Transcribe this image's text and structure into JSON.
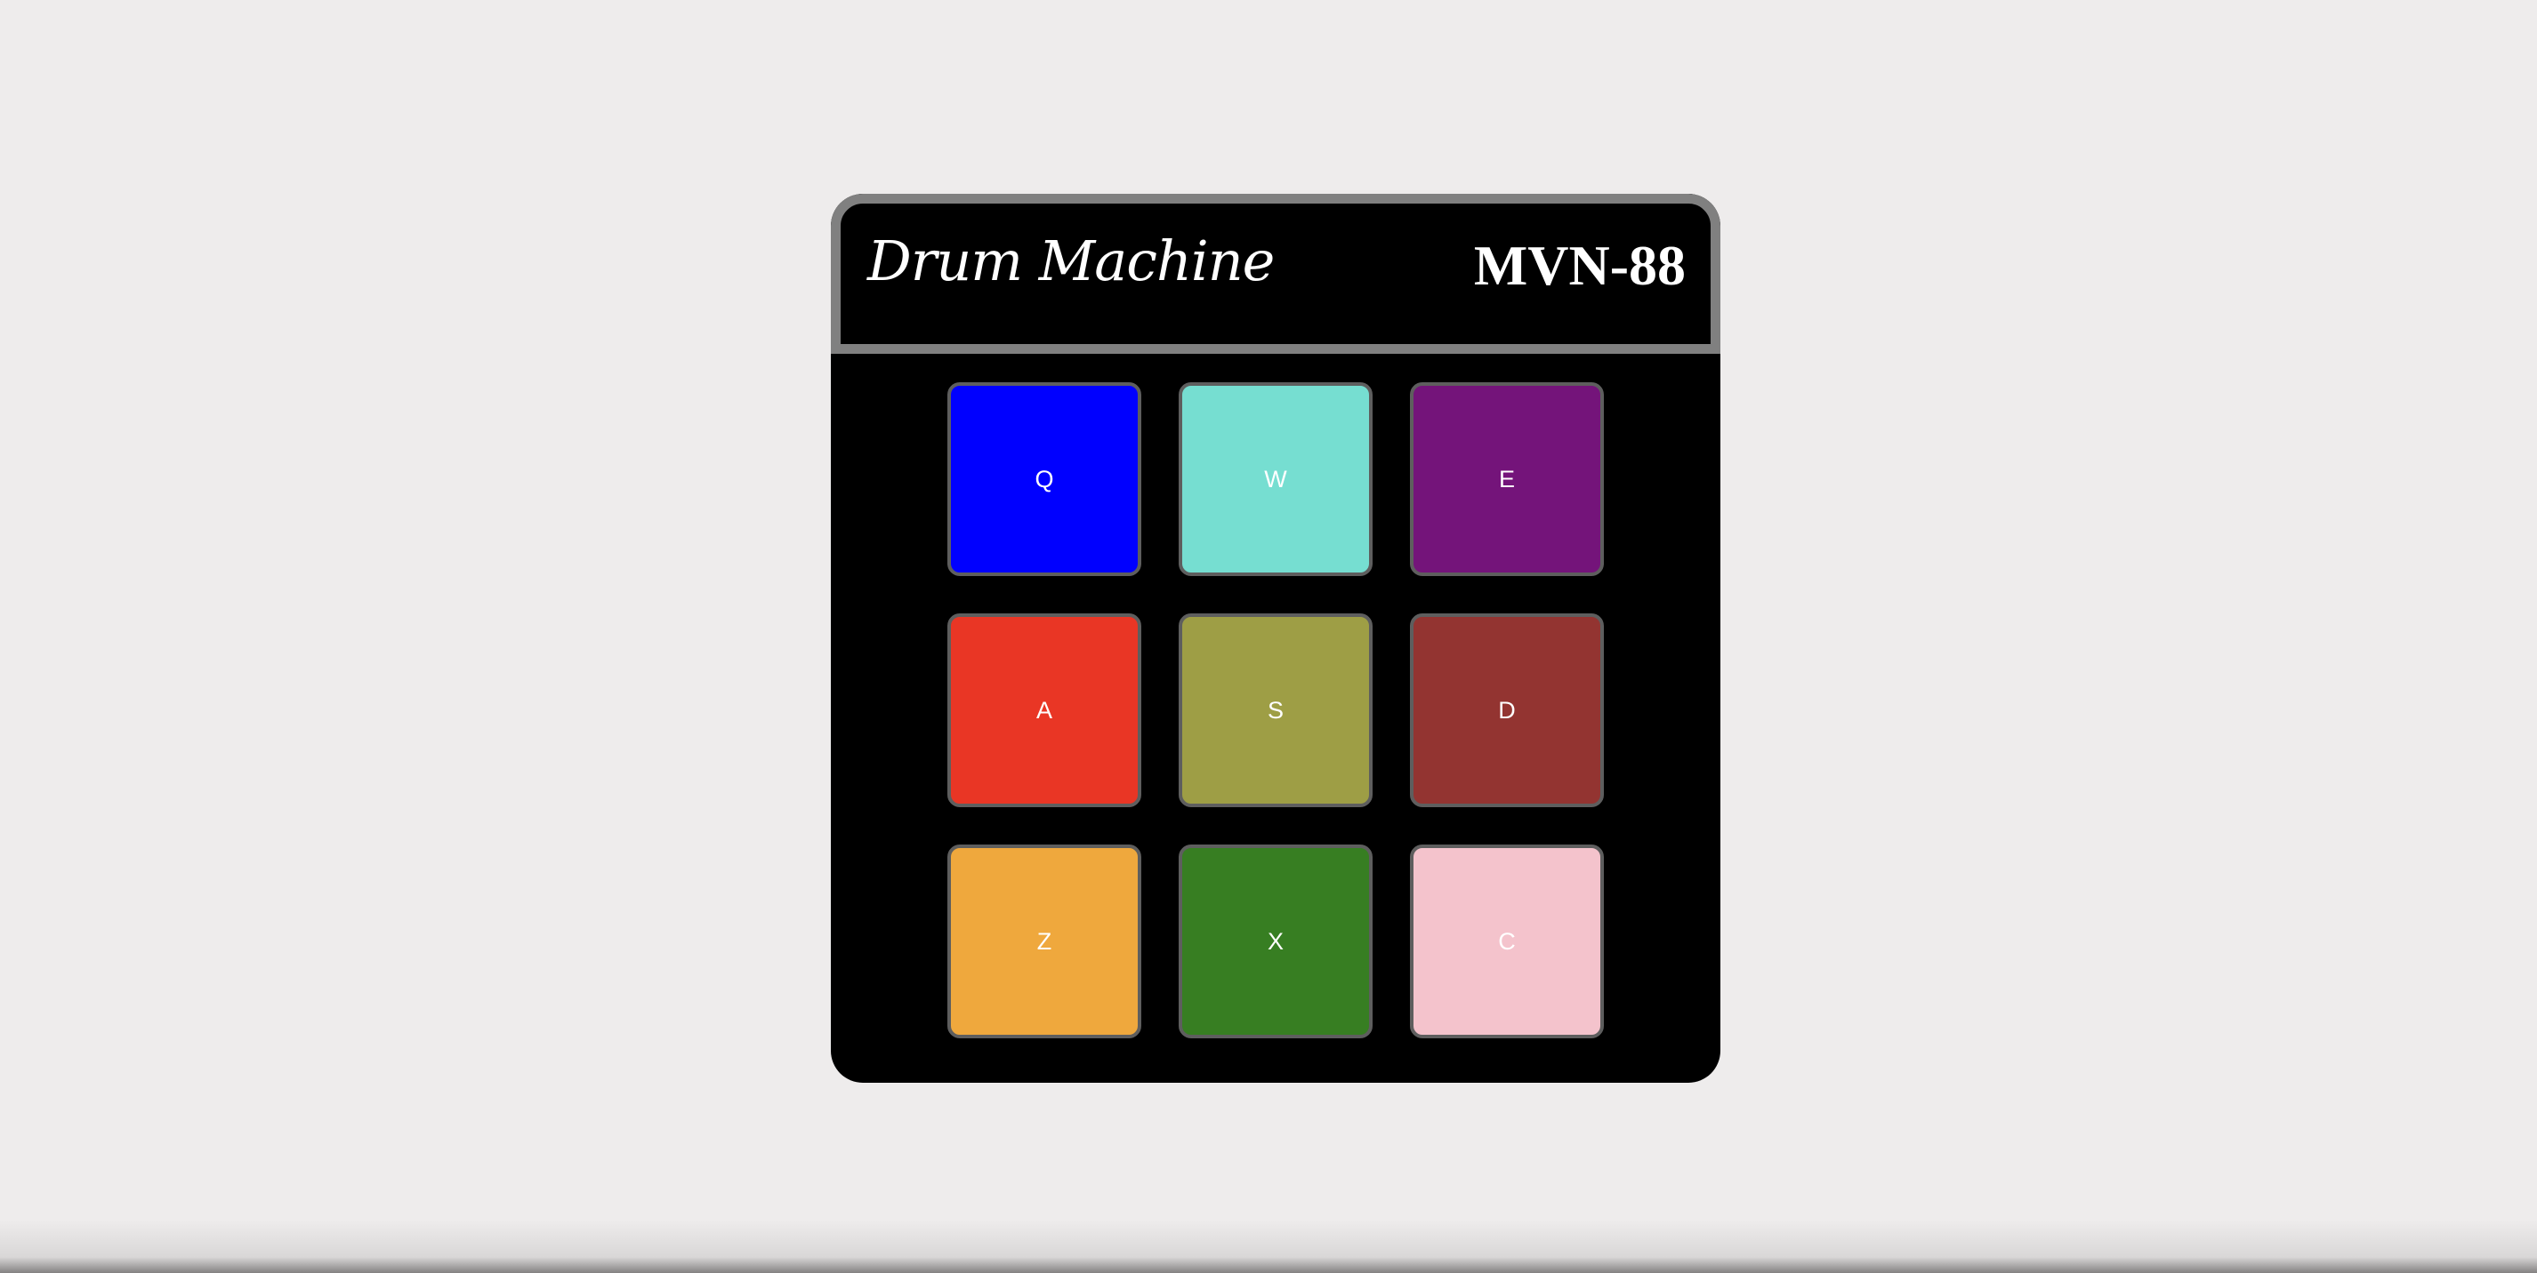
{
  "header": {
    "title": "Drum Machine",
    "model": "MVN-88"
  },
  "pads": [
    {
      "key": "Q",
      "color": "#0000ff"
    },
    {
      "key": "W",
      "color": "#76ded1"
    },
    {
      "key": "E",
      "color": "#74147a"
    },
    {
      "key": "A",
      "color": "#e93625"
    },
    {
      "key": "S",
      "color": "#9e9e45"
    },
    {
      "key": "D",
      "color": "#933431"
    },
    {
      "key": "Z",
      "color": "#efa83d"
    },
    {
      "key": "X",
      "color": "#377e22"
    },
    {
      "key": "C",
      "color": "#f4c3cc"
    }
  ]
}
